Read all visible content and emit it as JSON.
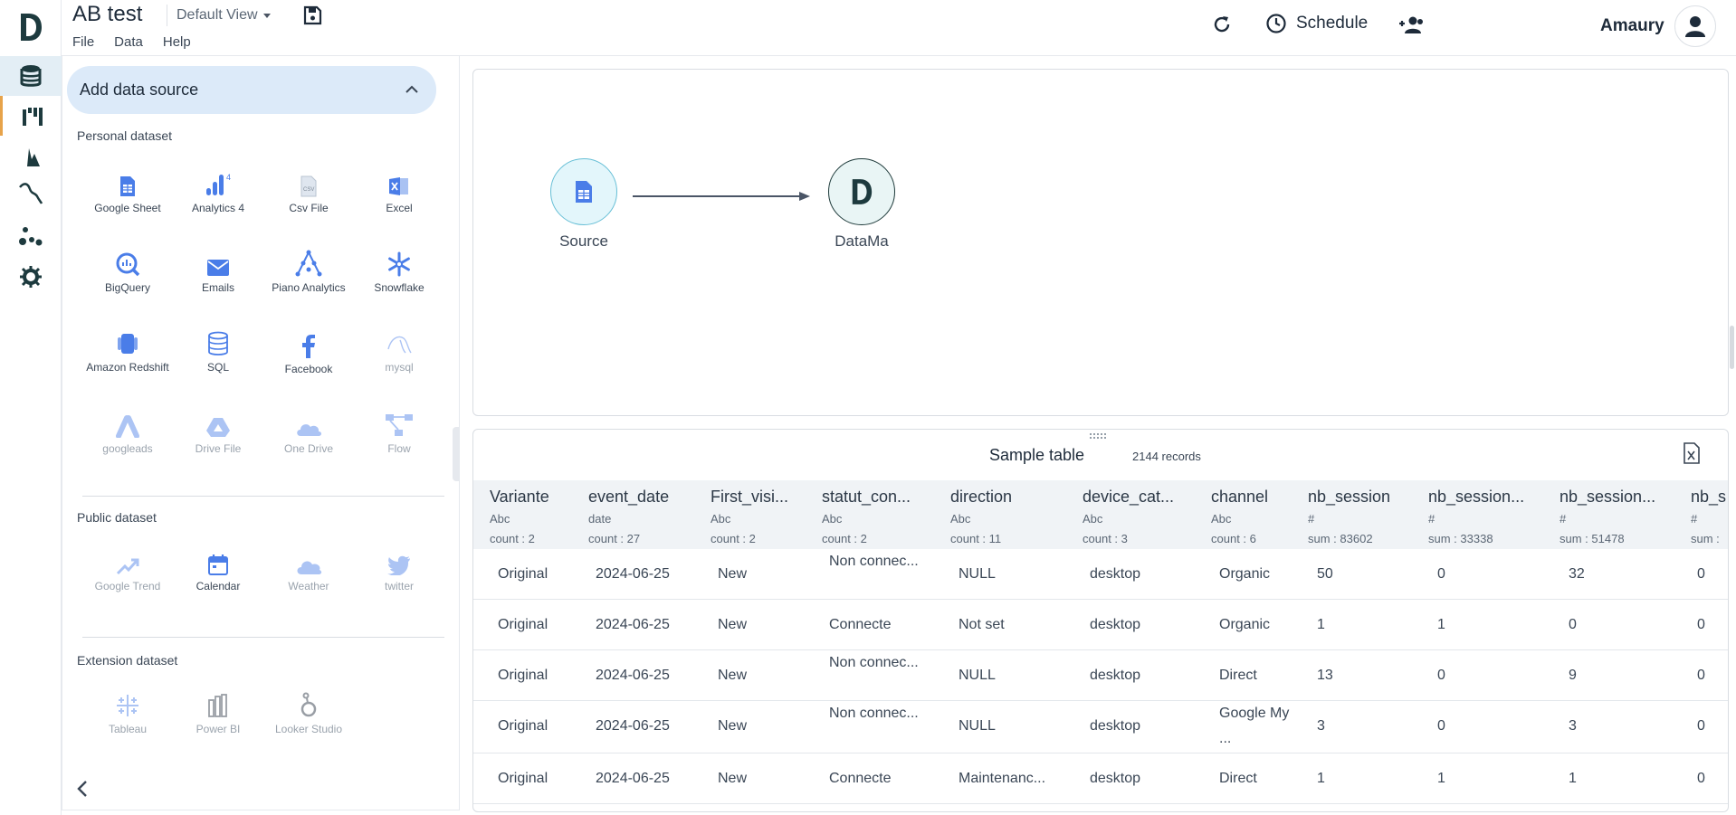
{
  "app": {
    "title": "AB test",
    "view_label": "Default View",
    "menus": [
      "File",
      "Data",
      "Help"
    ]
  },
  "header": {
    "schedule_label": "Schedule",
    "user_name": "Amaury"
  },
  "rail": {
    "items": [
      "database-icon",
      "columns-icon",
      "distribution-icon",
      "trend-icon",
      "cluster-icon",
      "settings-gear-icon"
    ]
  },
  "panel": {
    "title": "Add data source",
    "personal_label": "Personal dataset",
    "public_label": "Public dataset",
    "extension_label": "Extension dataset",
    "personal": [
      {
        "label": "Google Sheet",
        "icon": "google-sheet-icon",
        "enabled": true
      },
      {
        "label": "Analytics 4",
        "icon": "analytics-icon",
        "enabled": true
      },
      {
        "label": "Csv File",
        "icon": "csv-file-icon",
        "enabled": true
      },
      {
        "label": "Excel",
        "icon": "excel-icon",
        "enabled": true
      },
      {
        "label": "BigQuery",
        "icon": "bigquery-icon",
        "enabled": true
      },
      {
        "label": "Emails",
        "icon": "email-icon",
        "enabled": true
      },
      {
        "label": "Piano Analytics",
        "icon": "piano-analytics-icon",
        "enabled": true
      },
      {
        "label": "Snowflake",
        "icon": "snowflake-icon",
        "enabled": true
      },
      {
        "label": "Amazon Redshift",
        "icon": "redshift-icon",
        "enabled": true
      },
      {
        "label": "SQL",
        "icon": "sql-database-icon",
        "enabled": true
      },
      {
        "label": "Facebook",
        "icon": "facebook-icon",
        "enabled": true
      },
      {
        "label": "mysql",
        "icon": "mysql-icon",
        "enabled": false
      },
      {
        "label": "googleads",
        "icon": "google-ads-icon",
        "enabled": false
      },
      {
        "label": "Drive File",
        "icon": "drive-icon",
        "enabled": false
      },
      {
        "label": "One Drive",
        "icon": "onedrive-icon",
        "enabled": false
      },
      {
        "label": "Flow",
        "icon": "flow-icon",
        "enabled": false
      }
    ],
    "public": [
      {
        "label": "Google Trend",
        "icon": "trend-up-icon",
        "enabled": false
      },
      {
        "label": "Calendar",
        "icon": "calendar-icon",
        "enabled": true
      },
      {
        "label": "Weather",
        "icon": "cloud-icon",
        "enabled": false
      },
      {
        "label": "twitter",
        "icon": "twitter-icon",
        "enabled": false
      }
    ],
    "extension": [
      {
        "label": "Tableau",
        "icon": "tableau-icon",
        "enabled": false
      },
      {
        "label": "Power BI",
        "icon": "power-bi-icon",
        "enabled": false
      },
      {
        "label": "Looker Studio",
        "icon": "looker-icon",
        "enabled": false
      }
    ]
  },
  "flow": {
    "source_label": "Source",
    "target_label": "DataMa"
  },
  "table": {
    "title": "Sample table",
    "records": "2144 records",
    "columns": [
      {
        "name": "Variante",
        "type": "Abc",
        "agg": "count : 2"
      },
      {
        "name": "event_date",
        "type": "date",
        "agg": "count : 27"
      },
      {
        "name": "First_visi...",
        "type": "Abc",
        "agg": "count : 2"
      },
      {
        "name": "statut_con...",
        "type": "Abc",
        "agg": "count : 2"
      },
      {
        "name": "direction",
        "type": "Abc",
        "agg": "count : 11"
      },
      {
        "name": "device_cat...",
        "type": "Abc",
        "agg": "count : 3"
      },
      {
        "name": "channel",
        "type": "Abc",
        "agg": "count : 6"
      },
      {
        "name": "nb_session",
        "type": "#",
        "agg": "sum : 83602"
      },
      {
        "name": "nb_session...",
        "type": "#",
        "agg": "sum : 33338"
      },
      {
        "name": "nb_session...",
        "type": "#",
        "agg": "sum : 51478"
      },
      {
        "name": "nb_s",
        "type": "#",
        "agg": "sum :"
      }
    ],
    "rows": [
      [
        "Original",
        "2024-06-25",
        "New",
        "Non connec...",
        "NULL",
        "desktop",
        "Organic",
        "50",
        "0",
        "32",
        "0"
      ],
      [
        "Original",
        "2024-06-25",
        "New",
        "Connecte",
        "Not set",
        "desktop",
        "Organic",
        "1",
        "1",
        "0",
        "0"
      ],
      [
        "Original",
        "2024-06-25",
        "New",
        "Non connec...",
        "NULL",
        "desktop",
        "Direct",
        "13",
        "0",
        "9",
        "0"
      ],
      [
        "Original",
        "2024-06-25",
        "New",
        "Non connec...",
        "NULL",
        "desktop",
        "Google My ...",
        "3",
        "0",
        "3",
        "0"
      ],
      [
        "Original",
        "2024-06-25",
        "New",
        "Connecte",
        "Maintenanc...",
        "desktop",
        "Direct",
        "1",
        "1",
        "1",
        "0"
      ]
    ]
  }
}
